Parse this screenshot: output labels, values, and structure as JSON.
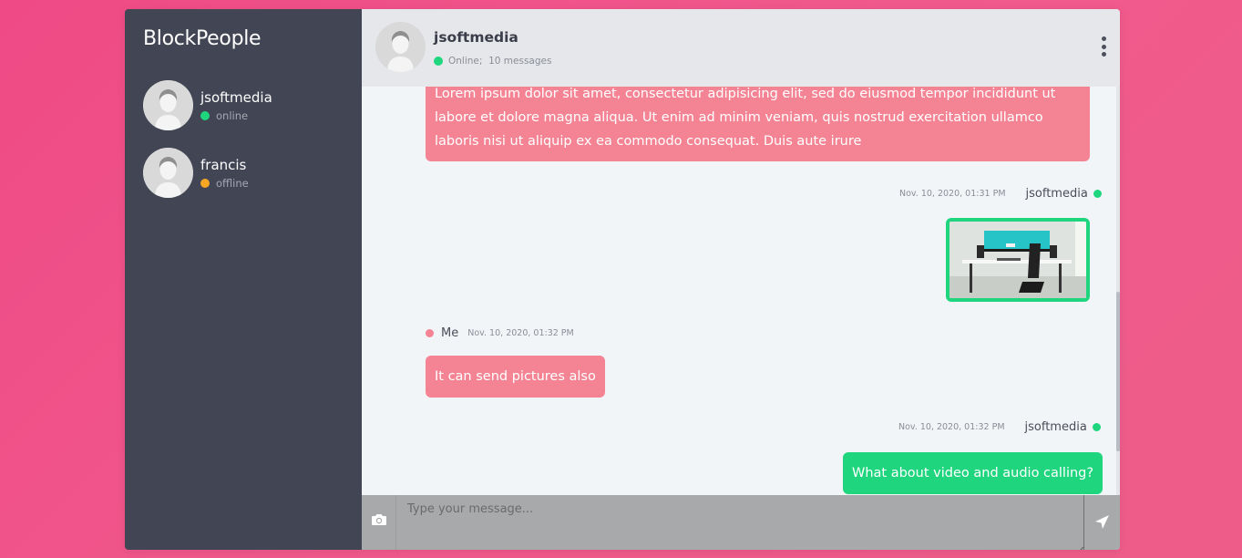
{
  "app": {
    "brand": "BlockPeople"
  },
  "colors": {
    "background": "#ef4a85",
    "online": "#1fd67e",
    "offline": "#f5a623",
    "me": "#f48494"
  },
  "contacts": [
    {
      "name": "jsoftmedia",
      "status": "online",
      "status_color": "#1fd67e",
      "icon": "user-avatar-icon"
    },
    {
      "name": "francis",
      "status": "offline",
      "status_color": "#f5a623",
      "icon": "user-avatar-icon"
    }
  ],
  "header": {
    "name": "jsoftmedia",
    "status": "Online",
    "separator": ";",
    "messages_count": "10 messages",
    "menu_icon": "vertical-dots-icon"
  },
  "messages": [
    {
      "sender": "",
      "time": "",
      "text": "Lorem ipsum dolor sit amet, consectetur adipisicing elit, sed do eiusmod tempor incididunt ut labore et dolore magna aliqua. Ut enim ad minim veniam, quis nostrud exercitation ullamco laboris nisi ut aliquip ex ea commodo consequat. Duis aute irure"
    },
    {
      "sender": "jsoftmedia",
      "time": "Nov. 10, 2020, 01:31 PM",
      "text": "",
      "image": "desk-setup-photo"
    },
    {
      "sender": "Me",
      "time": "Nov. 10, 2020, 01:32 PM",
      "text": "It can send pictures also"
    },
    {
      "sender": "jsoftmedia",
      "time": "Nov. 10, 2020, 01:32 PM",
      "text": "What about video and audio calling?"
    }
  ],
  "composer": {
    "placeholder": "Type your message...",
    "camera_icon": "camera-icon",
    "send_icon": "send-icon"
  }
}
